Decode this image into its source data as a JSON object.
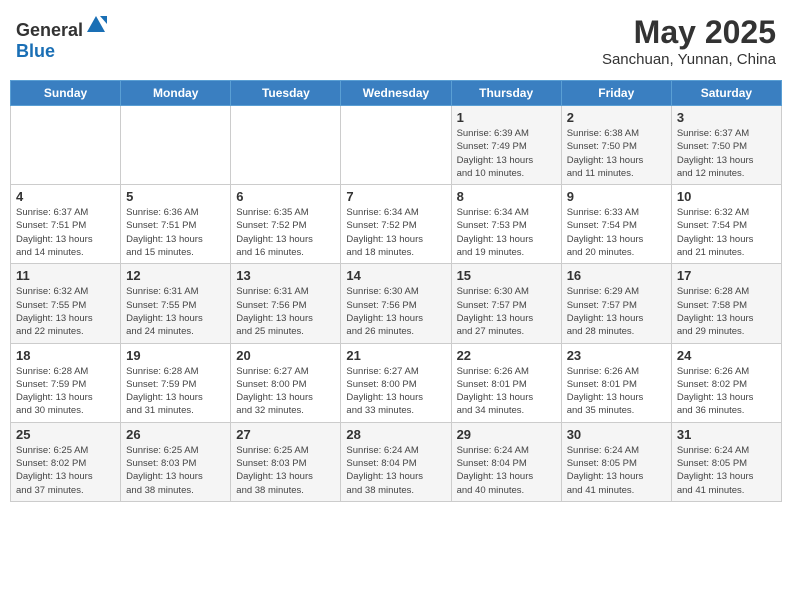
{
  "header": {
    "logo_general": "General",
    "logo_blue": "Blue",
    "month_year": "May 2025",
    "location": "Sanchuan, Yunnan, China"
  },
  "days_of_week": [
    "Sunday",
    "Monday",
    "Tuesday",
    "Wednesday",
    "Thursday",
    "Friday",
    "Saturday"
  ],
  "weeks": [
    [
      {
        "day": "",
        "info": ""
      },
      {
        "day": "",
        "info": ""
      },
      {
        "day": "",
        "info": ""
      },
      {
        "day": "",
        "info": ""
      },
      {
        "day": "1",
        "info": "Sunrise: 6:39 AM\nSunset: 7:49 PM\nDaylight: 13 hours\nand 10 minutes."
      },
      {
        "day": "2",
        "info": "Sunrise: 6:38 AM\nSunset: 7:50 PM\nDaylight: 13 hours\nand 11 minutes."
      },
      {
        "day": "3",
        "info": "Sunrise: 6:37 AM\nSunset: 7:50 PM\nDaylight: 13 hours\nand 12 minutes."
      }
    ],
    [
      {
        "day": "4",
        "info": "Sunrise: 6:37 AM\nSunset: 7:51 PM\nDaylight: 13 hours\nand 14 minutes."
      },
      {
        "day": "5",
        "info": "Sunrise: 6:36 AM\nSunset: 7:51 PM\nDaylight: 13 hours\nand 15 minutes."
      },
      {
        "day": "6",
        "info": "Sunrise: 6:35 AM\nSunset: 7:52 PM\nDaylight: 13 hours\nand 16 minutes."
      },
      {
        "day": "7",
        "info": "Sunrise: 6:34 AM\nSunset: 7:52 PM\nDaylight: 13 hours\nand 18 minutes."
      },
      {
        "day": "8",
        "info": "Sunrise: 6:34 AM\nSunset: 7:53 PM\nDaylight: 13 hours\nand 19 minutes."
      },
      {
        "day": "9",
        "info": "Sunrise: 6:33 AM\nSunset: 7:54 PM\nDaylight: 13 hours\nand 20 minutes."
      },
      {
        "day": "10",
        "info": "Sunrise: 6:32 AM\nSunset: 7:54 PM\nDaylight: 13 hours\nand 21 minutes."
      }
    ],
    [
      {
        "day": "11",
        "info": "Sunrise: 6:32 AM\nSunset: 7:55 PM\nDaylight: 13 hours\nand 22 minutes."
      },
      {
        "day": "12",
        "info": "Sunrise: 6:31 AM\nSunset: 7:55 PM\nDaylight: 13 hours\nand 24 minutes."
      },
      {
        "day": "13",
        "info": "Sunrise: 6:31 AM\nSunset: 7:56 PM\nDaylight: 13 hours\nand 25 minutes."
      },
      {
        "day": "14",
        "info": "Sunrise: 6:30 AM\nSunset: 7:56 PM\nDaylight: 13 hours\nand 26 minutes."
      },
      {
        "day": "15",
        "info": "Sunrise: 6:30 AM\nSunset: 7:57 PM\nDaylight: 13 hours\nand 27 minutes."
      },
      {
        "day": "16",
        "info": "Sunrise: 6:29 AM\nSunset: 7:57 PM\nDaylight: 13 hours\nand 28 minutes."
      },
      {
        "day": "17",
        "info": "Sunrise: 6:28 AM\nSunset: 7:58 PM\nDaylight: 13 hours\nand 29 minutes."
      }
    ],
    [
      {
        "day": "18",
        "info": "Sunrise: 6:28 AM\nSunset: 7:59 PM\nDaylight: 13 hours\nand 30 minutes."
      },
      {
        "day": "19",
        "info": "Sunrise: 6:28 AM\nSunset: 7:59 PM\nDaylight: 13 hours\nand 31 minutes."
      },
      {
        "day": "20",
        "info": "Sunrise: 6:27 AM\nSunset: 8:00 PM\nDaylight: 13 hours\nand 32 minutes."
      },
      {
        "day": "21",
        "info": "Sunrise: 6:27 AM\nSunset: 8:00 PM\nDaylight: 13 hours\nand 33 minutes."
      },
      {
        "day": "22",
        "info": "Sunrise: 6:26 AM\nSunset: 8:01 PM\nDaylight: 13 hours\nand 34 minutes."
      },
      {
        "day": "23",
        "info": "Sunrise: 6:26 AM\nSunset: 8:01 PM\nDaylight: 13 hours\nand 35 minutes."
      },
      {
        "day": "24",
        "info": "Sunrise: 6:26 AM\nSunset: 8:02 PM\nDaylight: 13 hours\nand 36 minutes."
      }
    ],
    [
      {
        "day": "25",
        "info": "Sunrise: 6:25 AM\nSunset: 8:02 PM\nDaylight: 13 hours\nand 37 minutes."
      },
      {
        "day": "26",
        "info": "Sunrise: 6:25 AM\nSunset: 8:03 PM\nDaylight: 13 hours\nand 38 minutes."
      },
      {
        "day": "27",
        "info": "Sunrise: 6:25 AM\nSunset: 8:03 PM\nDaylight: 13 hours\nand 38 minutes."
      },
      {
        "day": "28",
        "info": "Sunrise: 6:24 AM\nSunset: 8:04 PM\nDaylight: 13 hours\nand 38 minutes."
      },
      {
        "day": "29",
        "info": "Sunrise: 6:24 AM\nSunset: 8:04 PM\nDaylight: 13 hours\nand 40 minutes."
      },
      {
        "day": "30",
        "info": "Sunrise: 6:24 AM\nSunset: 8:05 PM\nDaylight: 13 hours\nand 41 minutes."
      },
      {
        "day": "31",
        "info": "Sunrise: 6:24 AM\nSunset: 8:05 PM\nDaylight: 13 hours\nand 41 minutes."
      }
    ]
  ]
}
